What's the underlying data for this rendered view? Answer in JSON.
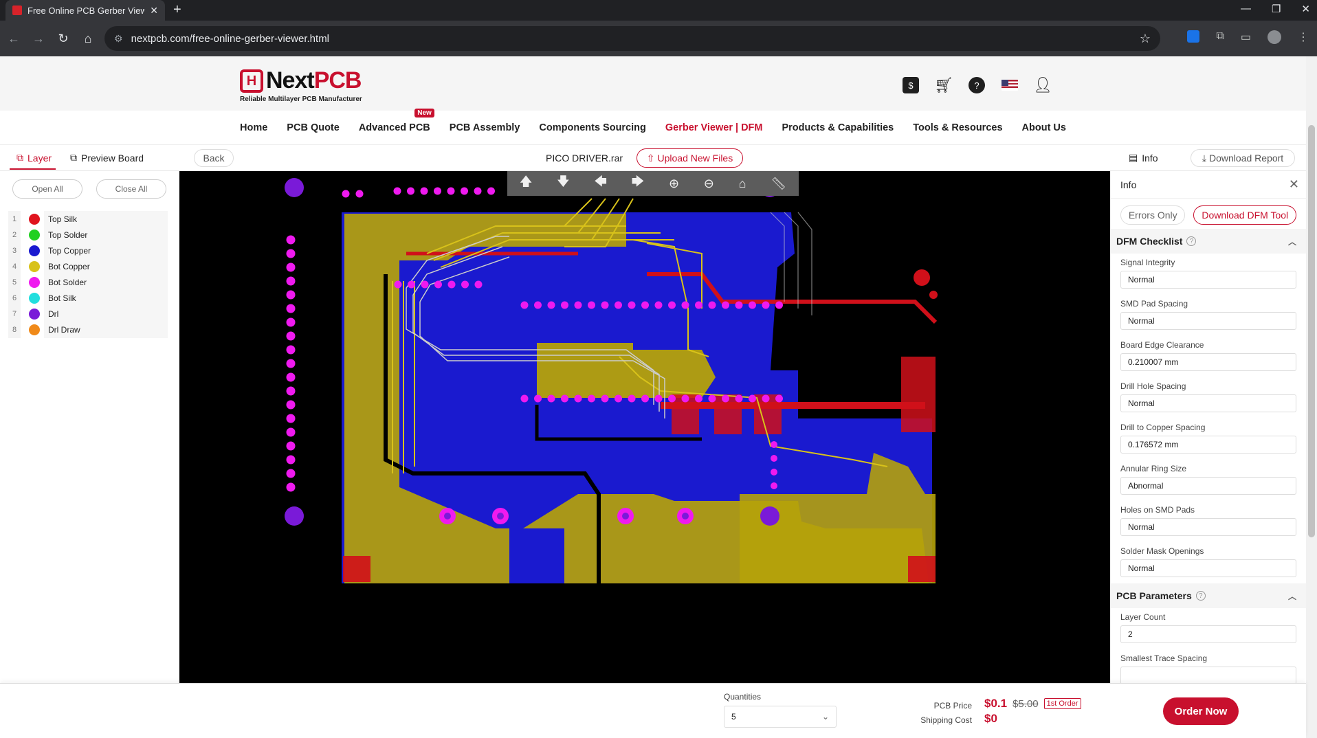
{
  "browser": {
    "tab_title": "Free Online PCB Gerber Viewer",
    "url": "nextpcb.com/free-online-gerber-viewer.html"
  },
  "header": {
    "logo_mark": "H",
    "logo_next": "Next",
    "logo_pcb": "PCB",
    "logo_tagline": "Reliable Multilayer PCB Manufacturer"
  },
  "nav": {
    "items": [
      "Home",
      "PCB Quote",
      "Advanced PCB",
      "PCB Assembly",
      "Components Sourcing",
      "Gerber Viewer | DFM",
      "Products & Capabilities",
      "Tools & Resources",
      "About Us"
    ],
    "new_badge": "New",
    "active_index": 5
  },
  "viewer_bar": {
    "layer_tab": "Layer",
    "preview_tab": "Preview Board",
    "back": "Back",
    "file_name": "PICO DRIVER.rar",
    "upload": "Upload New Files",
    "info": "Info",
    "download_report": "Download Report"
  },
  "layers": {
    "open_all": "Open All",
    "close_all": "Close All",
    "items": [
      {
        "num": "1",
        "name": "Top Silk",
        "color": "#e0141e"
      },
      {
        "num": "2",
        "name": "Top Solder",
        "color": "#22d022"
      },
      {
        "num": "3",
        "name": "Top Copper",
        "color": "#1a1ad0"
      },
      {
        "num": "4",
        "name": "Bot Copper",
        "color": "#d8c21a"
      },
      {
        "num": "5",
        "name": "Bot Solder",
        "color": "#ef1aef"
      },
      {
        "num": "6",
        "name": "Bot Silk",
        "color": "#22dede"
      },
      {
        "num": "7",
        "name": "Drl",
        "color": "#7a1ad8"
      },
      {
        "num": "8",
        "name": "Drl Draw",
        "color": "#f08a1a"
      }
    ]
  },
  "info_panel": {
    "title": "Info",
    "errors_only": "Errors Only",
    "download_dfm": "Download DFM Tool",
    "dfm_checklist": "DFM Checklist",
    "checks": [
      {
        "label": "Signal Integrity",
        "value": "Normal"
      },
      {
        "label": "SMD Pad Spacing",
        "value": "Normal"
      },
      {
        "label": "Board Edge Clearance",
        "value": "0.210007 mm"
      },
      {
        "label": "Drill Hole Spacing",
        "value": "Normal"
      },
      {
        "label": "Drill to Copper Spacing",
        "value": "0.176572 mm"
      },
      {
        "label": "Annular Ring Size",
        "value": "Abnormal"
      },
      {
        "label": "Holes on SMD Pads",
        "value": "Normal"
      },
      {
        "label": "Solder Mask Openings",
        "value": "Normal"
      }
    ],
    "pcb_parameters": "PCB Parameters",
    "params": [
      {
        "label": "Layer Count",
        "value": "2"
      },
      {
        "label": "Smallest Trace Spacing",
        "value": ""
      }
    ]
  },
  "footer": {
    "quantities_label": "Quantities",
    "quantity_value": "5",
    "pcb_price_label": "PCB Price",
    "shipping_label": "Shipping Cost",
    "pcb_price": "$0.1",
    "pcb_price_original": "$5.00",
    "first_order": "1st Order",
    "shipping_cost": "$0",
    "order_now": "Order Now"
  }
}
